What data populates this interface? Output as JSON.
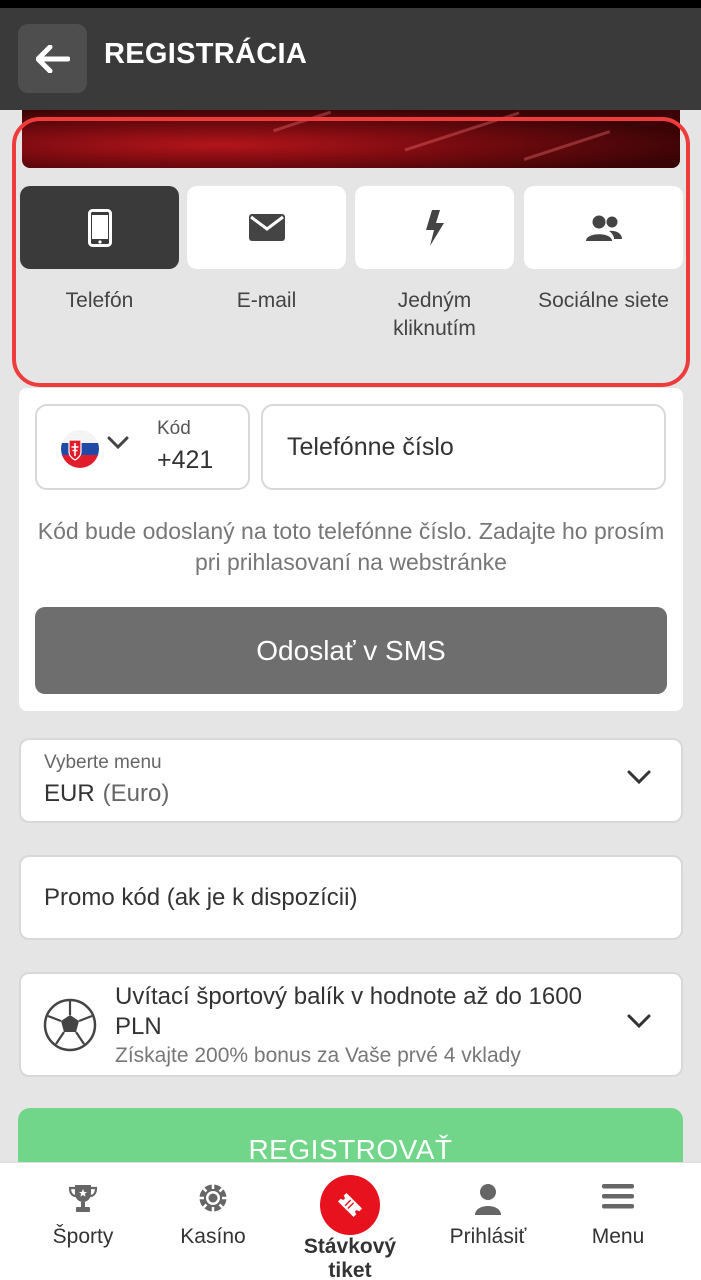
{
  "header": {
    "title": "REGISTRÁCIA"
  },
  "methods": [
    {
      "label": "Telefón",
      "icon": "phone-icon",
      "active": true
    },
    {
      "label": "E-mail",
      "icon": "mail-icon",
      "active": false
    },
    {
      "label": "Jedným kliknutím",
      "icon": "lightning-icon",
      "active": false
    },
    {
      "label": "Sociálne siete",
      "icon": "people-icon",
      "active": false
    }
  ],
  "phone": {
    "code_label": "Kód",
    "code_value": "+421",
    "phone_placeholder": "Telefónne číslo",
    "hint": "Kód bude odoslaný na toto telefónne číslo. Zadajte ho prosím pri prihlasovaní na webstránke",
    "sms_button": "Odoslať v SMS"
  },
  "currency": {
    "label": "Vyberte menu",
    "code": "EUR",
    "name": "(Euro)"
  },
  "promo": {
    "placeholder": "Promo kód (ak je k dispozícii)"
  },
  "bonus": {
    "title": "Uvítací športový balík v hodnote až do 1600 PLN",
    "subtitle": "Získajte 200% bonus za Vaše prvé 4 vklady"
  },
  "register_button": "REGISTROVAŤ",
  "nav": [
    {
      "label": "Športy",
      "icon": "trophy-icon"
    },
    {
      "label": "Kasíno",
      "icon": "casino-chip-icon"
    },
    {
      "label": "Stávkový tiket",
      "icon": "ticket-icon"
    },
    {
      "label": "Prihlásiť",
      "icon": "user-icon"
    },
    {
      "label": "Menu",
      "icon": "hamburger-icon"
    }
  ],
  "colors": {
    "header": "#3a3a3a",
    "accent_red": "#e8111e",
    "highlight": "#ee3b3b",
    "register_green": "#72d68a",
    "button_gray": "#6e6e6e"
  }
}
